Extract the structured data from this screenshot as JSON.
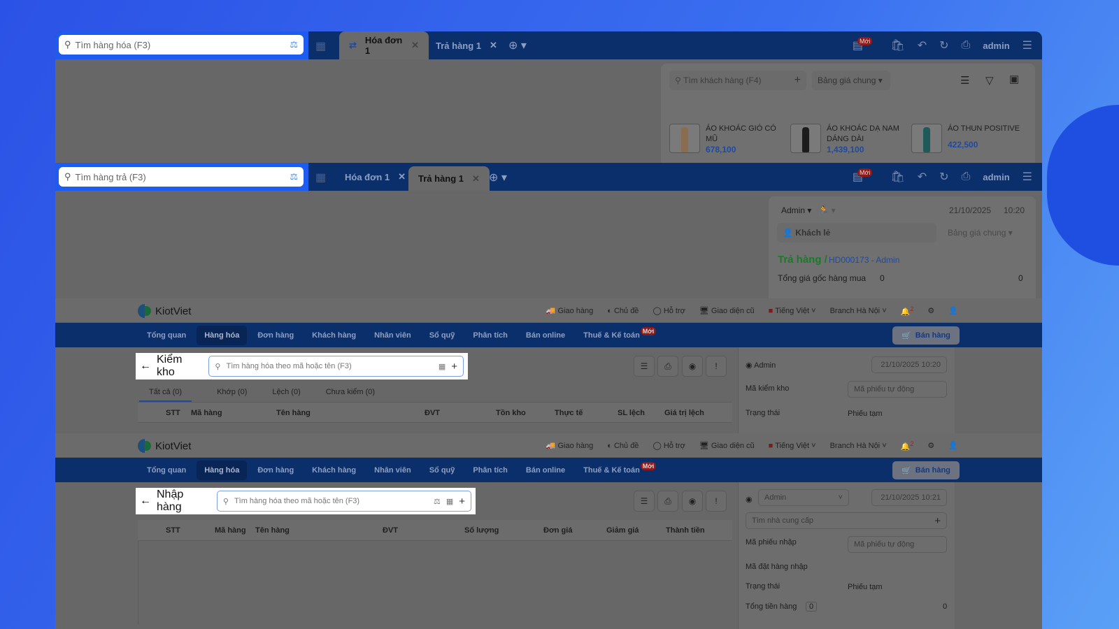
{
  "pos_sale": {
    "search_placeholder": "Tìm hàng hóa (F3)",
    "tabs": [
      {
        "label": "Hóa đơn 1",
        "active": true
      },
      {
        "label": "Trả hàng 1",
        "active": false
      }
    ],
    "new_badge": "Mới",
    "user": "admin",
    "customer_search": "Tìm khách hàng (F4)",
    "price_list": "Bảng giá chung",
    "products": [
      {
        "name": "ÁO KHOÁC GIÓ CÓ MŨ",
        "price": "678,100",
        "color": "#8a6d4f"
      },
      {
        "name": "ÁO KHOÁC DẠ NAM DÁNG DÀI",
        "price": "1,439,100",
        "color": "#1c1c1c"
      },
      {
        "name": "ÁO THUN POSITIVE",
        "price": "422,500",
        "color": "#1f5a5a"
      }
    ]
  },
  "pos_return": {
    "search_placeholder": "Tìm hàng trả (F3)",
    "tabs": [
      {
        "label": "Hóa đơn 1",
        "active": false
      },
      {
        "label": "Trả hàng 1",
        "active": true
      }
    ],
    "new_badge": "Mới",
    "user": "admin",
    "seller": "Admin",
    "date": "21/10/2025",
    "time": "10:20",
    "customer": "Khách lẻ",
    "price_list": "Bảng giá chung",
    "return_title": "Trả hàng /",
    "invoice_ref": "HD000173 - Admin",
    "total_label": "Tổng giá gốc hàng mua",
    "total_qty": "0",
    "total_value": "0"
  },
  "header": {
    "brand": "KiotViet",
    "links": [
      "Giao hàng",
      "Chủ đề",
      "Hỗ trợ",
      "Giao diện cũ"
    ],
    "language": "Tiếng Việt",
    "branch": "Branch Hà Nội",
    "notif_count": "2",
    "nav": [
      "Tổng quan",
      "Hàng hóa",
      "Đơn hàng",
      "Khách hàng",
      "Nhân viên",
      "Sổ quỹ",
      "Phân tích",
      "Bán online",
      "Thuế & Kế toán"
    ],
    "nav_new": "Mới",
    "sell_button": "Bán hàng"
  },
  "stocktake": {
    "title": "Kiểm kho",
    "search_placeholder": "Tìm hàng hóa theo mã hoặc tên (F3)",
    "filters": [
      "Tất cả (0)",
      "Khớp (0)",
      "Lệch (0)",
      "Chưa kiểm (0)"
    ],
    "columns": [
      "STT",
      "Mã hàng",
      "Tên hàng",
      "ĐVT",
      "Tồn kho",
      "Thực tế",
      "SL lệch",
      "Giá trị lệch"
    ],
    "user": "Admin",
    "datetime": "21/10/2025 10:20",
    "code_label": "Mã kiểm kho",
    "code_placeholder": "Mã phiếu tự động",
    "status_label": "Trạng thái",
    "status": "Phiếu tạm"
  },
  "import": {
    "title": "Nhập hàng",
    "search_placeholder": "Tìm hàng hóa theo mã hoặc tên (F3)",
    "columns": [
      "STT",
      "Mã hàng",
      "Tên hàng",
      "ĐVT",
      "Số lượng",
      "Đơn giá",
      "Giảm giá",
      "Thành tiền"
    ],
    "user": "Admin",
    "datetime": "21/10/2025 10:21",
    "supplier_placeholder": "Tìm nhà cung cấp",
    "code_label": "Mã phiếu nhập",
    "code_placeholder": "Mã phiếu tự động",
    "order_label": "Mã đặt hàng nhập",
    "status_label": "Trạng thái",
    "status": "Phiếu tạm",
    "total_label": "Tổng tiền hàng",
    "total_qty": "0",
    "total_value": "0"
  }
}
